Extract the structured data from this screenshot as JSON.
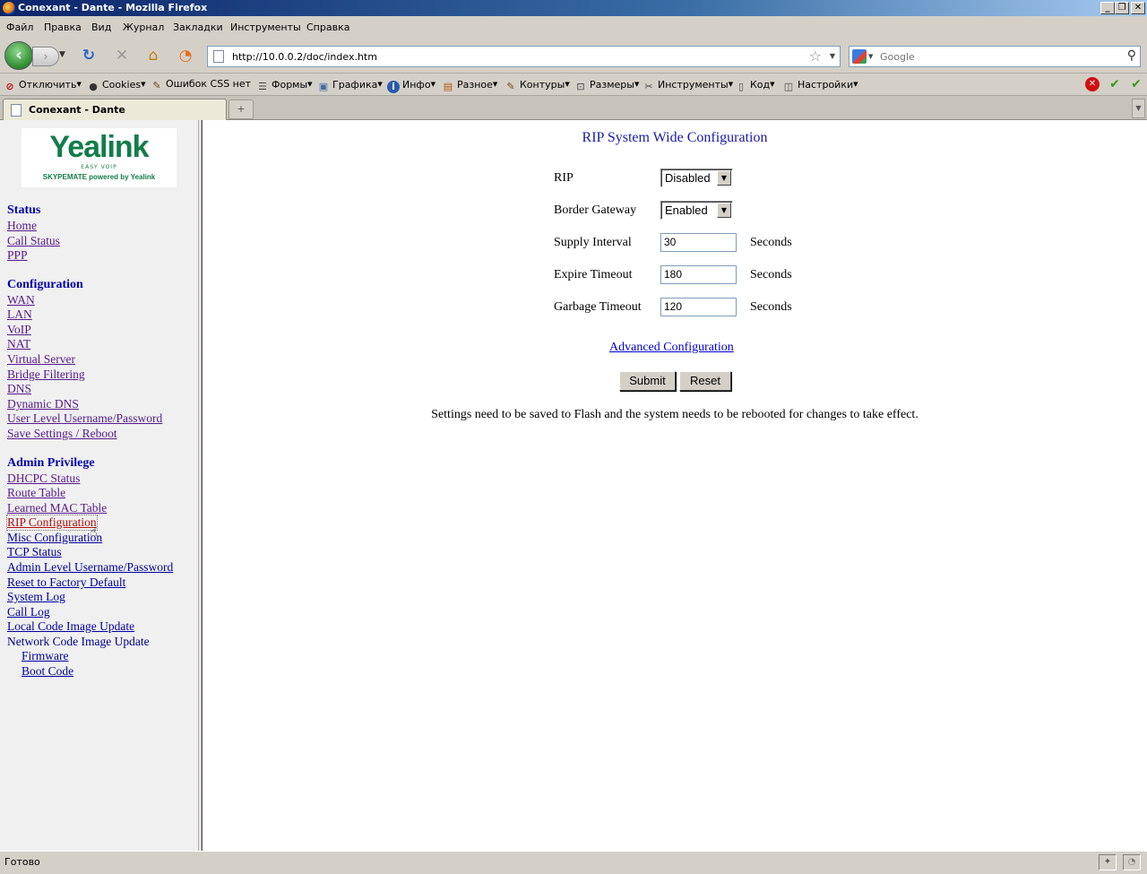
{
  "window": {
    "title": "Conexant - Dante - Mozilla Firefox",
    "minimize": "_",
    "restore": "❐",
    "close": "✕"
  },
  "menu": [
    "Файл",
    "Правка",
    "Вид",
    "Журнал",
    "Закладки",
    "Инструменты",
    "Справка"
  ],
  "navigation": {
    "url": "http://10.0.0.2/doc/index.htm",
    "search_placeholder": "Google"
  },
  "dev_toolbar": {
    "items": [
      "Отключить",
      "Cookies",
      "Ошибок CSS нет",
      "Формы",
      "Графика",
      "Инфо",
      "Разное",
      "Контуры",
      "Размеры",
      "Инструменты",
      "Код",
      "Настройки"
    ]
  },
  "tab": {
    "label": "Conexant - Dante",
    "new_tab": "+"
  },
  "sidebar": {
    "logo": {
      "brand": "Yealink",
      "tagline": "EASY VOIP",
      "subtitle": "SKYPEMATE powered by Yealink"
    },
    "sections": {
      "status": "Status",
      "configuration": "Configuration",
      "admin": "Admin Privilege"
    },
    "status_links": [
      "Home",
      "Call Status",
      "PPP"
    ],
    "config_links": [
      "WAN",
      "LAN",
      "VoIP",
      "NAT",
      "Virtual Server",
      "Bridge Filtering",
      "DNS",
      "Dynamic DNS",
      "User Level Username/Password",
      "Save Settings / Reboot"
    ],
    "admin_links": [
      "DHCPC Status",
      "Route Table",
      "Learned MAC Table",
      "RIP Configuration",
      "Misc Configuration",
      "TCP Status",
      "Admin Level Username/Password",
      "Reset to Factory Default",
      "System Log",
      "Call Log",
      "Local Code Image Update",
      "Network Code Image Update"
    ],
    "sub_links": [
      "Firmware",
      "Boot Code"
    ]
  },
  "form": {
    "title": "RIP System Wide Configuration",
    "rip_label": "RIP",
    "rip_value": "Disabled",
    "border_gateway_label": "Border Gateway",
    "border_gateway_value": "Enabled",
    "supply_interval_label": "Supply Interval",
    "supply_interval_value": "30",
    "expire_timeout_label": "Expire Timeout",
    "expire_timeout_value": "180",
    "garbage_timeout_label": "Garbage Timeout",
    "garbage_timeout_value": "120",
    "unit": "Seconds",
    "advanced_link": "Advanced Configuration",
    "submit": "Submit",
    "reset": "Reset",
    "note": "Settings need to be saved to Flash and the system needs to be rebooted for changes to take effect."
  },
  "statusbar": {
    "text": "Готово"
  },
  "colors": {
    "link": "#00009c",
    "visited": "#551a8b",
    "active_link": "#b01010",
    "brand_green": "#127d49",
    "title_blue": "#1a1aa6"
  }
}
